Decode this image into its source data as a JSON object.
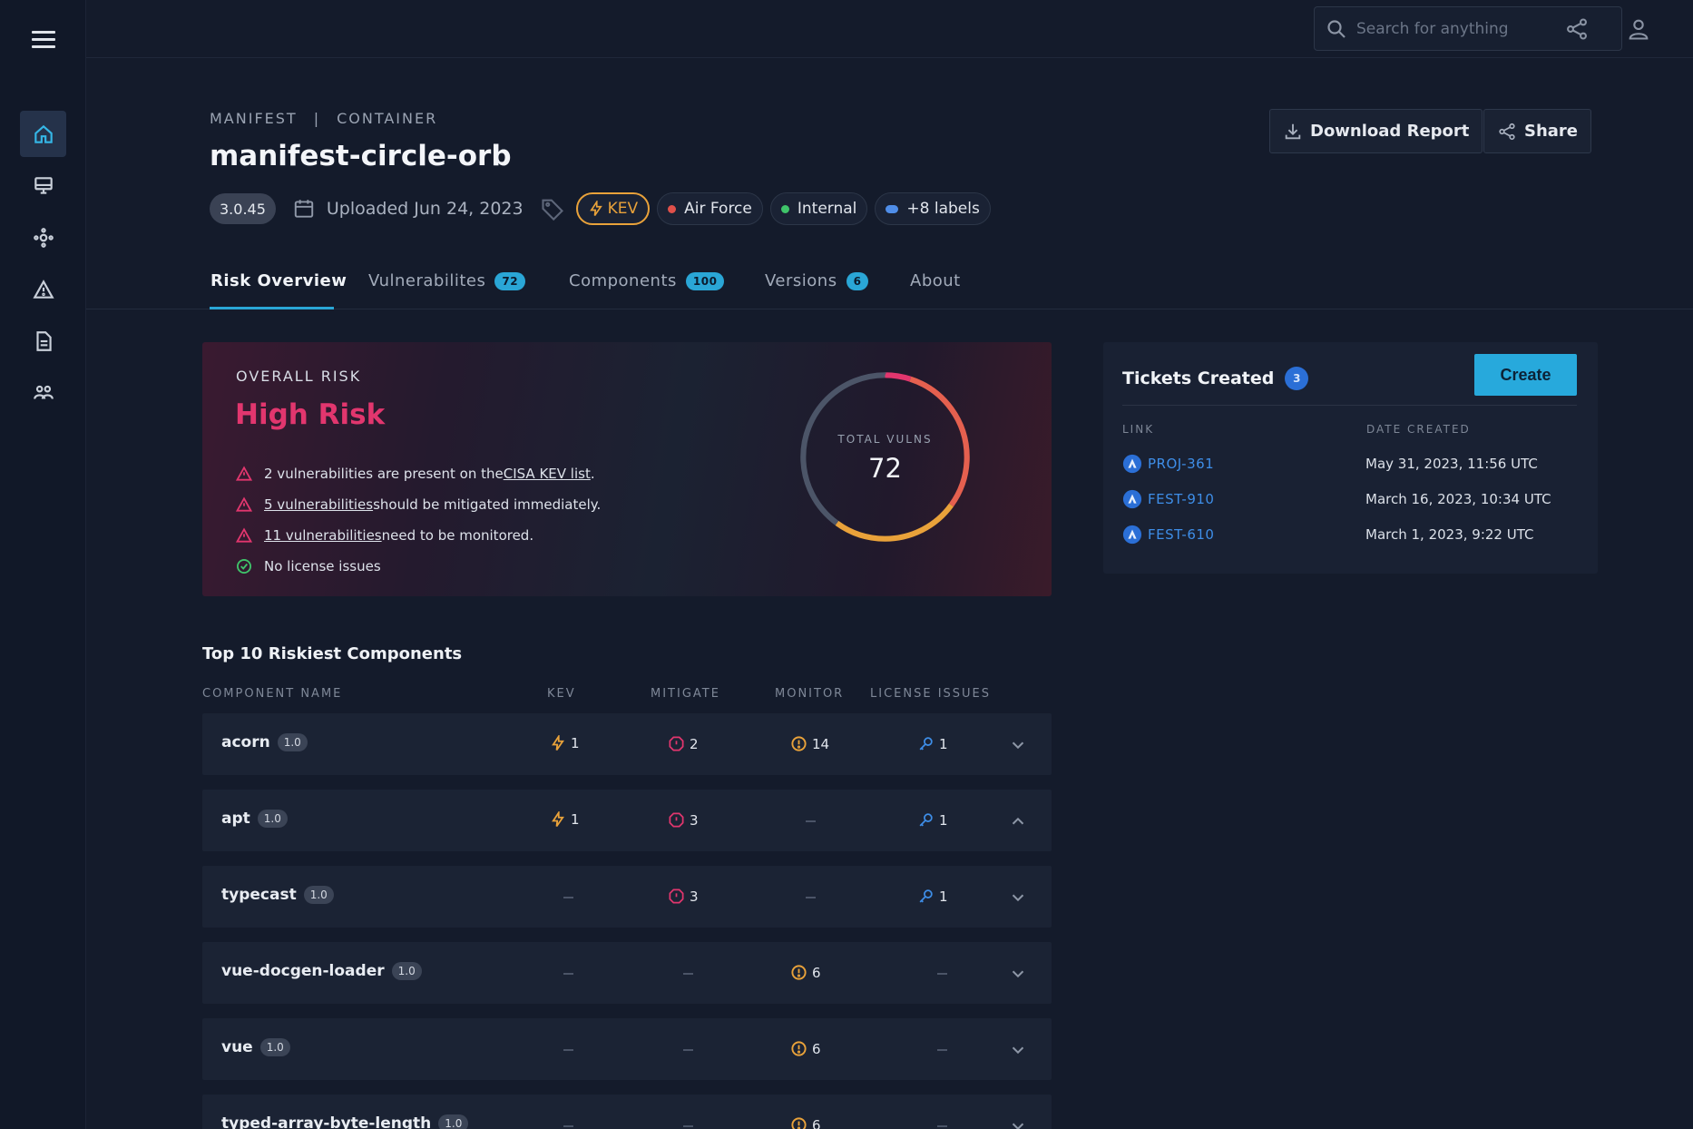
{
  "nav": {
    "menu_icon": "hamburger-icon",
    "items": [
      {
        "name": "home",
        "icon": "home-icon",
        "active": true
      },
      {
        "name": "devices",
        "icon": "monitor-icon",
        "active": false
      },
      {
        "name": "components",
        "icon": "components-icon",
        "active": false
      },
      {
        "name": "vulnerabilities",
        "icon": "warning-icon",
        "active": false
      },
      {
        "name": "reports",
        "icon": "document-icon",
        "active": false
      },
      {
        "name": "teams",
        "icon": "team-icon",
        "active": false
      }
    ]
  },
  "topbar": {
    "search_placeholder": "Search for anything",
    "share_icon": "share-icon",
    "user_icon": "user-icon"
  },
  "header": {
    "breadcrumb": [
      "MANIFEST",
      "|",
      "CONTAINER"
    ],
    "title": "manifest-circle-orb",
    "version": "3.0.45",
    "uploaded": "Uploaded Jun 24, 2023",
    "chips": [
      {
        "label": "KEV",
        "kind": "kev",
        "color": "#e9a23a"
      },
      {
        "label": "Air Force",
        "color": "#e0504a"
      },
      {
        "label": "Internal",
        "color": "#3fc46a"
      },
      {
        "label": "+8 labels",
        "color": "#4f8de8"
      }
    ],
    "download_label": "Download Report",
    "share_label": "Share"
  },
  "tabs": [
    {
      "label": "Risk Overview",
      "active": true
    },
    {
      "label": "Vulnerabilites",
      "count": "72"
    },
    {
      "label": "Components",
      "count": "100"
    },
    {
      "label": "Versions",
      "count": "6"
    },
    {
      "label": "About"
    }
  ],
  "risk": {
    "label": "OVERALL RISK",
    "headline": "High Risk",
    "items": [
      {
        "status": "warning",
        "link": "",
        "text": "2 vulnerabilities are present on the ",
        "link_after": "CISA KEV list",
        "suffix": "."
      },
      {
        "status": "warning",
        "link": "5 vulnerabilities",
        "text": " should be mitigated immediately."
      },
      {
        "status": "warning",
        "link": "11 vulnerabilities",
        "text": " need to be monitored."
      },
      {
        "status": "ok",
        "link": "",
        "text": "No license issues"
      }
    ],
    "donut_label": "TOTAL VULNS",
    "donut_value": "72",
    "donut_segments": [
      {
        "fraction": 0.05,
        "color": "#e2366e"
      },
      {
        "fraction": 0.3,
        "color": "#e5604f"
      },
      {
        "fraction": 0.25,
        "color": "#e9a23a"
      },
      {
        "fraction": 0.4,
        "color": "#4c5568"
      }
    ],
    "colors": {
      "warning": "#e2366e",
      "ok": "#3fc46a"
    }
  },
  "tickets": {
    "title": "Tickets Created",
    "count": "3",
    "create_label": "Create",
    "col_link": "LINK",
    "col_date": "DATE CREATED",
    "rows": [
      {
        "id": "PROJ-361",
        "date": "May 31, 2023, 11:56 UTC"
      },
      {
        "id": "FEST-910",
        "date": "March 16, 2023, 10:34 UTC"
      },
      {
        "id": "FEST-610",
        "date": "March 1, 2023, 9:22 UTC"
      }
    ]
  },
  "components": {
    "title": "Top 10 Riskiest Components",
    "columns": [
      "COMPONENT NAME",
      "KEV",
      "MITIGATE",
      "MONITOR",
      "LICENSE ISSUES"
    ],
    "rows": [
      {
        "name": "acorn",
        "version": "1.0",
        "kev": "1",
        "mitigate": "2",
        "monitor": "14",
        "license": "1",
        "expanded": false
      },
      {
        "name": "apt",
        "version": "1.0",
        "kev": "1",
        "mitigate": "3",
        "monitor": "",
        "license": "1",
        "expanded": true
      },
      {
        "name": "typecast",
        "version": "1.0",
        "kev": "",
        "mitigate": "3",
        "monitor": "",
        "license": "1",
        "expanded": false
      },
      {
        "name": "vue-docgen-loader",
        "version": "1.0",
        "kev": "",
        "mitigate": "",
        "monitor": "6",
        "license": "",
        "expanded": false
      },
      {
        "name": "vue",
        "version": "1.0",
        "kev": "",
        "mitigate": "",
        "monitor": "6",
        "license": "",
        "expanded": false
      },
      {
        "name": "typed-array-byte-length",
        "version": "1.0",
        "kev": "",
        "mitigate": "",
        "monitor": "6",
        "license": "",
        "expanded": false
      }
    ]
  }
}
